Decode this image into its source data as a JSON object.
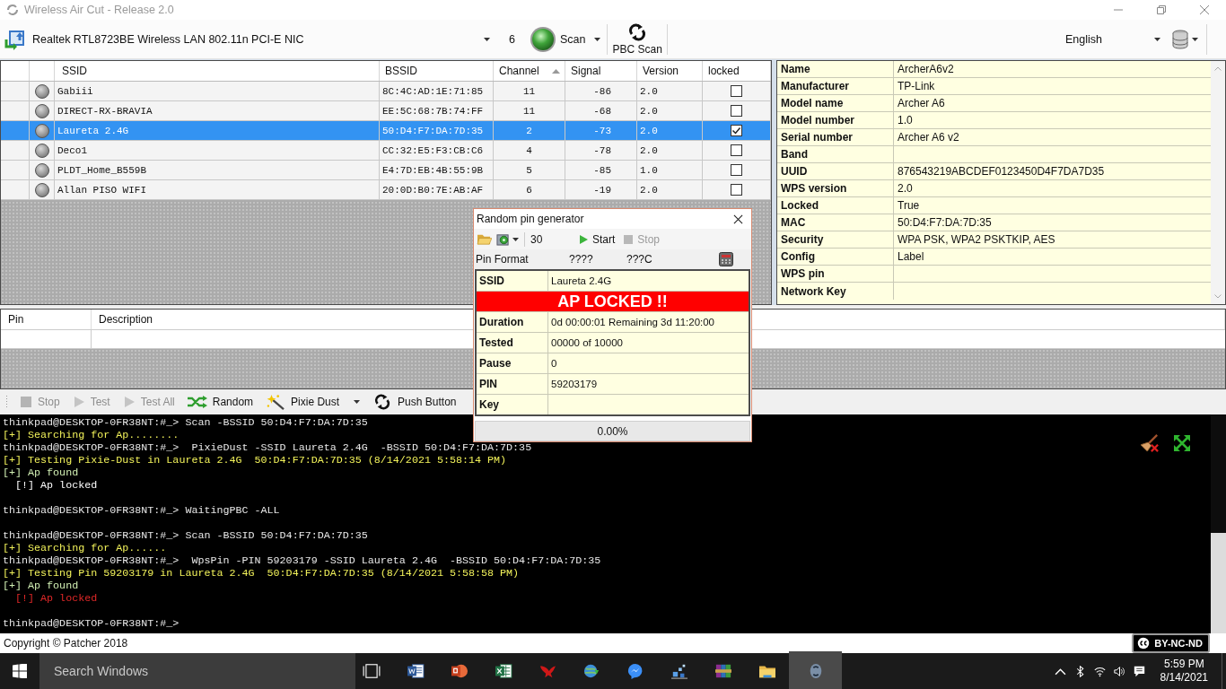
{
  "window": {
    "title": "Wireless Air Cut - Release 2.0"
  },
  "toolbar": {
    "adapter": "Realtek RTL8723BE Wireless LAN 802.11n PCI-E NIC",
    "count": "6",
    "scan": "Scan",
    "pbc_scan": "PBC Scan",
    "language": "English"
  },
  "networks": {
    "columns": [
      {
        "label": "SSID",
        "sorted": false
      },
      {
        "label": "BSSID",
        "sorted": false
      },
      {
        "label": "Channel",
        "sorted": true
      },
      {
        "label": "Signal",
        "sorted": false
      },
      {
        "label": "Version",
        "sorted": false
      },
      {
        "label": "locked",
        "sorted": false
      }
    ],
    "rows": [
      {
        "ssid": "Gabiii",
        "bssid": "8C:4C:AD:1E:71:85",
        "channel": "11",
        "signal": "-86",
        "version": "2.0",
        "locked": false,
        "selected": false
      },
      {
        "ssid": "DIRECT-RX-BRAVIA",
        "bssid": "EE:5C:68:7B:74:FF",
        "channel": "11",
        "signal": "-68",
        "version": "2.0",
        "locked": false,
        "selected": false
      },
      {
        "ssid": "Laureta 2.4G",
        "bssid": "50:D4:F7:DA:7D:35",
        "channel": "2",
        "signal": "-73",
        "version": "2.0",
        "locked": true,
        "selected": true
      },
      {
        "ssid": "Deco1",
        "bssid": "CC:32:E5:F3:CB:C6",
        "channel": "4",
        "signal": "-78",
        "version": "2.0",
        "locked": false,
        "selected": false
      },
      {
        "ssid": "PLDT_Home_B559B",
        "bssid": "E4:7D:EB:4B:55:9B",
        "channel": "5",
        "signal": "-85",
        "version": "1.0",
        "locked": false,
        "selected": false
      },
      {
        "ssid": "Allan PISO WIFI",
        "bssid": "20:0D:B0:7E:AB:AF",
        "channel": "6",
        "signal": "-19",
        "version": "2.0",
        "locked": false,
        "selected": false
      }
    ]
  },
  "details": [
    {
      "label": "Name",
      "value": "ArcherA6v2"
    },
    {
      "label": "Manufacturer",
      "value": "TP-Link"
    },
    {
      "label": "Model name",
      "value": "Archer A6"
    },
    {
      "label": "Model number",
      "value": "1.0"
    },
    {
      "label": "Serial number",
      "value": "Archer A6 v2"
    },
    {
      "label": "Band"
    },
    {
      "label": "UUID",
      "value": "876543219ABCDEF0123450D4F7DA7D35"
    },
    {
      "label": "WPS version",
      "value": "2.0"
    },
    {
      "label": "Locked",
      "value": "True"
    },
    {
      "label": "MAC",
      "value": "50:D4:F7:DA:7D:35"
    },
    {
      "label": "Security",
      "value": "WPA PSK, WPA2 PSKTKIP, AES"
    },
    {
      "label": "Config",
      "value": "Label"
    },
    {
      "label": "WPS pin"
    },
    {
      "label": "Network Key"
    }
  ],
  "pins": {
    "columns": [
      "Pin",
      "Description"
    ]
  },
  "actions": [
    {
      "kind": "stop",
      "label": "Stop",
      "disabled": true,
      "has_menu": false
    },
    {
      "kind": "play",
      "label": "Test",
      "disabled": true,
      "has_menu": false
    },
    {
      "kind": "play",
      "label": "Test All",
      "disabled": true,
      "has_menu": false
    },
    {
      "kind": "shuffle",
      "label": "Random",
      "disabled": false,
      "has_menu": false
    },
    {
      "kind": "wand",
      "label": "Pixie Dust",
      "disabled": false,
      "has_menu": true
    },
    {
      "kind": "swirl",
      "label": "Push Button",
      "disabled": false,
      "has_menu": false
    }
  ],
  "console": {
    "blocks": [
      [
        {
          "text": "thinkpad@DESKTOP-0FR38NT:#_> Scan -BSSID 50:D4:F7:DA:7D:35",
          "color": "#e8e8e8"
        },
        {
          "text": "[+] Searching for Ap........",
          "color": "#f2f25a"
        },
        {
          "text": "thinkpad@DESKTOP-0FR38NT:#_>  PixieDust -SSID Laureta 2.4G  -BSSID 50:D4:F7:DA:7D:35",
          "color": "#e8e8e8"
        },
        {
          "text": "[+] Testing Pixie-Dust in Laureta 2.4G  50:D4:F7:DA:7D:35 (8/14/2021 5:58:14 PM)",
          "color": "#f2f25a"
        },
        {
          "text": "[+] Ap found",
          "color": "#d2f0b4"
        },
        {
          "text": "  [!] Ap locked",
          "color": "#ffffff"
        }
      ],
      [
        {
          "text": "thinkpad@DESKTOP-0FR38NT:#_> WaitingPBC -ALL",
          "color": "#e8e8e8"
        }
      ],
      [
        {
          "text": "thinkpad@DESKTOP-0FR38NT:#_> Scan -BSSID 50:D4:F7:DA:7D:35",
          "color": "#e8e8e8"
        },
        {
          "text": "[+] Searching for Ap......",
          "color": "#f2f25a"
        },
        {
          "text": "thinkpad@DESKTOP-0FR38NT:#_>  WpsPin -PIN 59203179 -SSID Laureta 2.4G  -BSSID 50:D4:F7:DA:7D:35",
          "color": "#e8e8e8"
        },
        {
          "text": "[+] Testing Pin 59203179 in Laureta 2.4G  50:D4:F7:DA:7D:35 (8/14/2021 5:58:58 PM)",
          "color": "#f2f25a"
        },
        {
          "text": "[+] Ap found",
          "color": "#d2f0b4"
        },
        {
          "text": "  [!] Ap locked",
          "color": "#e02828"
        }
      ],
      [
        {
          "text": "thinkpad@DESKTOP-0FR38NT:#_>",
          "color": "#e8e8e8"
        }
      ]
    ]
  },
  "dialog": {
    "title": "Random pin generator",
    "count": "30",
    "buttons": [
      {
        "kind": "start",
        "label": "Start",
        "disabled": false
      },
      {
        "kind": "stop",
        "label": "Stop",
        "disabled": true
      }
    ],
    "pin_format": {
      "label": "Pin Format",
      "parts": [
        "????",
        "???C"
      ]
    },
    "rows": [
      {
        "kind": "field",
        "label": "SSID",
        "value": "Laureta 2.4G"
      },
      {
        "kind": "banner",
        "text": "AP LOCKED !!"
      },
      {
        "kind": "field",
        "label": "Duration",
        "value": "0d 00:00:01 Remaining 3d 11:20:00"
      },
      {
        "kind": "field",
        "label": "Tested",
        "value": "00000 of 10000"
      },
      {
        "kind": "field",
        "label": "Pause",
        "value": "0"
      },
      {
        "kind": "field",
        "label": "PIN",
        "value": "59203179"
      },
      {
        "kind": "field",
        "label": "Key"
      }
    ],
    "progress": {
      "level": 0,
      "text": "0.00%"
    }
  },
  "status_bar": {
    "copyright": "Copyright © Patcher 2018",
    "license": "BY-NC-ND"
  },
  "taskbar": {
    "search_placeholder": "Search Windows",
    "apps": [
      {
        "kind": "word",
        "active": false
      },
      {
        "kind": "powerpoint",
        "active": false
      },
      {
        "kind": "excel",
        "active": false
      },
      {
        "kind": "red_app",
        "active": false
      },
      {
        "kind": "globe",
        "active": false
      },
      {
        "kind": "messenger",
        "active": false
      },
      {
        "kind": "sparkle_app",
        "active": false
      },
      {
        "kind": "archive",
        "active": false
      },
      {
        "kind": "folder",
        "active": false
      },
      {
        "kind": "wifi_tool",
        "active": true
      }
    ],
    "time": "5:59 PM",
    "date": "8/14/2021"
  }
}
